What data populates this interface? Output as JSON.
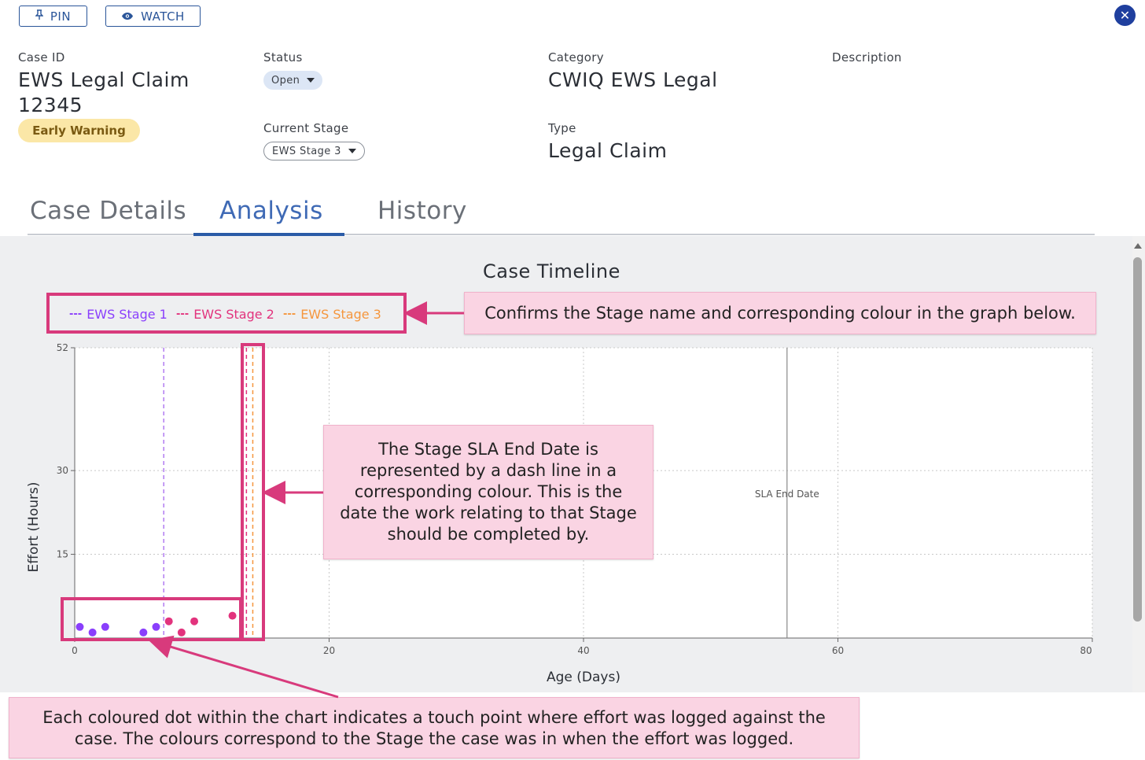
{
  "toolbar": {
    "pin_label": "PIN",
    "watch_label": "WATCH"
  },
  "header": {
    "case_id_label": "Case ID",
    "case_id_line1": "EWS Legal Claim",
    "case_id_line2": "12345",
    "warning_badge": "Early Warning",
    "status_label": "Status",
    "status_value": "Open",
    "current_stage_label": "Current Stage",
    "current_stage_value": "EWS Stage 3",
    "category_label": "Category",
    "category_value": "CWIQ EWS Legal",
    "type_label": "Type",
    "type_value": "Legal Claim",
    "description_label": "Description"
  },
  "tabs": [
    {
      "label": "Case Details",
      "active": false
    },
    {
      "label": "Analysis",
      "active": true
    },
    {
      "label": "History",
      "active": false
    }
  ],
  "chart_data": {
    "type": "scatter",
    "title": "Case Timeline",
    "xlabel": "Age (Days)",
    "ylabel": "Effort (Hours)",
    "x_range": [
      0,
      80
    ],
    "y_range": [
      0,
      52
    ],
    "x_ticks": [
      0,
      20,
      40,
      60,
      80
    ],
    "y_ticks": [
      15,
      30,
      52
    ],
    "grid": true,
    "legend": [
      {
        "name": "EWS Stage 1",
        "color": "#8a3ffc"
      },
      {
        "name": "EWS Stage 2",
        "color": "#e2337d"
      },
      {
        "name": "EWS Stage 3",
        "color": "#f5963d"
      }
    ],
    "series": [
      {
        "name": "EWS Stage 1",
        "color": "#8a3ffc",
        "points": [
          [
            0.4,
            2.0
          ],
          [
            1.4,
            1.0
          ],
          [
            2.4,
            2.0
          ],
          [
            5.4,
            1.0
          ],
          [
            6.4,
            2.0
          ]
        ]
      },
      {
        "name": "EWS Stage 2",
        "color": "#e2337d",
        "points": [
          [
            7.4,
            3.0
          ],
          [
            8.4,
            1.0
          ],
          [
            9.4,
            3.0
          ],
          [
            12.4,
            4.0
          ]
        ]
      }
    ],
    "stage_sla_lines": [
      {
        "stage": "EWS Stage 1",
        "x": 7.0,
        "color": "#b27cf2"
      },
      {
        "stage": "EWS Stage 2",
        "x": 13.5,
        "color": "#e2337d"
      },
      {
        "stage": "EWS Stage 3",
        "x": 14.0,
        "color": "#f5963d"
      }
    ],
    "sla_end": {
      "x": 56.0,
      "label": "SLA End Date"
    }
  },
  "callouts": {
    "legend_note": "Confirms the Stage name and corresponding colour in the graph below.",
    "sla_note": "The Stage SLA End Date is represented by a dash line in a corresponding colour. This is the date the work relating to that Stage should be completed by.",
    "dots_note": "Each coloured dot within the chart indicates a touch point where effort was logged against the case. The colours correspond to the Stage the case was in when the effort was logged."
  },
  "icons": {
    "pin": "pin-icon",
    "watch": "eye-icon",
    "close": "close-icon"
  }
}
